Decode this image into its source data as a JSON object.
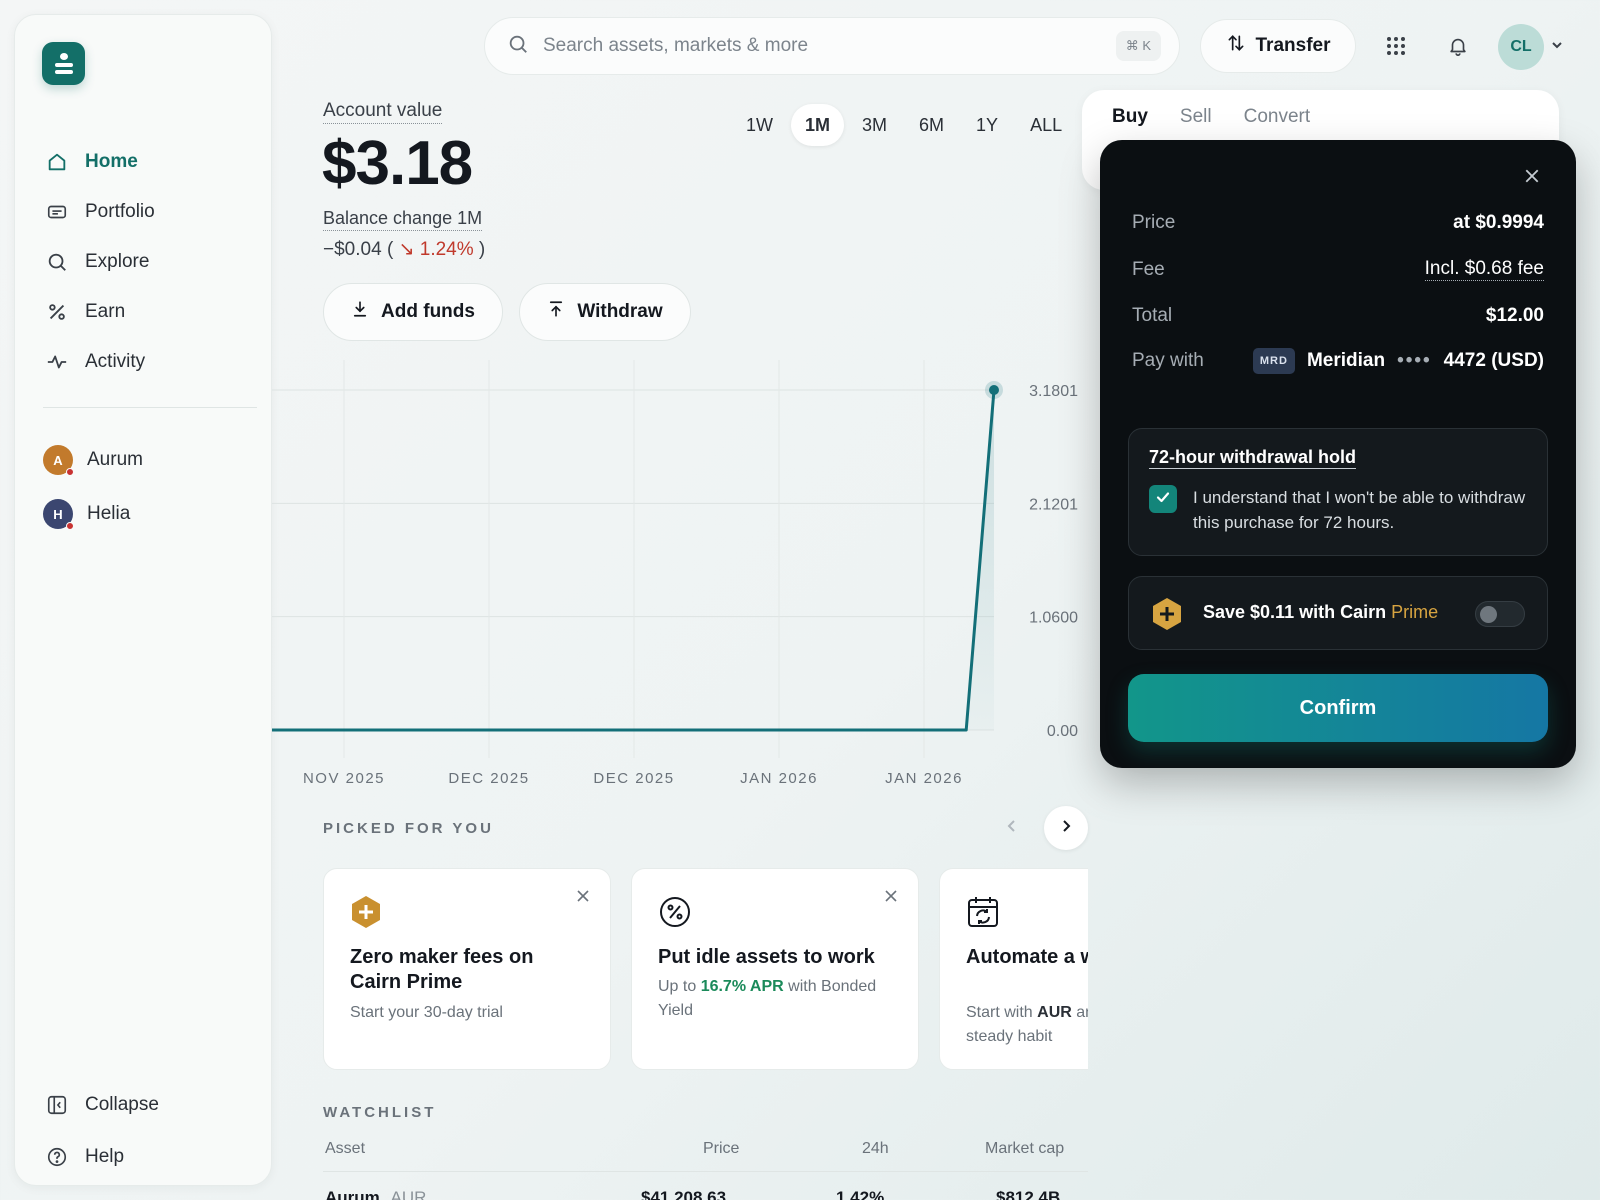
{
  "sidebar": {
    "nav": [
      {
        "label": "Home",
        "icon": "home-icon"
      },
      {
        "label": "Portfolio",
        "icon": "wallet-icon"
      },
      {
        "label": "Explore",
        "icon": "search-icon"
      },
      {
        "label": "Earn",
        "icon": "percent-icon"
      },
      {
        "label": "Activity",
        "icon": "activity-icon"
      }
    ],
    "wallets": [
      {
        "initial": "A",
        "label": "Aurum",
        "color": "#c27a2c"
      },
      {
        "initial": "H",
        "label": "Helia",
        "color": "#3b4670"
      }
    ],
    "collapse_label": "Collapse",
    "help_label": "Help"
  },
  "topbar": {
    "search_placeholder": "Search assets, markets & more",
    "search_shortcut": "⌘ K",
    "transfer_label": "Transfer",
    "avatar_initials": "CL"
  },
  "account": {
    "label": "Account value",
    "value": "$3.18",
    "balance_label": "Balance change 1M",
    "balance_change": "−$0.04",
    "balance_pct": "1.24%",
    "add_funds_label": "Add funds",
    "withdraw_label": "Withdraw"
  },
  "ranges": {
    "options": [
      "1W",
      "1M",
      "3M",
      "6M",
      "1Y",
      "ALL"
    ],
    "selected": "1M"
  },
  "chart_data": {
    "type": "line",
    "x_tick_labels": [
      "NOV 2025",
      "DEC 2025",
      "DEC 2025",
      "JAN 2026",
      "JAN 2026"
    ],
    "y_tick_labels": [
      "3.1801",
      "2.1201",
      "1.0600",
      "0.00"
    ],
    "ylim": [
      0,
      3.1801
    ],
    "values": [
      0,
      0,
      0,
      0,
      0,
      0,
      0,
      0,
      0,
      0,
      0,
      0,
      0,
      0,
      0,
      0,
      0,
      0,
      0,
      0,
      0,
      0,
      0,
      0,
      0,
      0,
      3.1801
    ],
    "color": "#136f78",
    "grid": true
  },
  "picked": {
    "title": "PICKED FOR YOU",
    "cards": [
      {
        "icon": "prime-hexagon-icon",
        "title": "Zero maker fees on Cairn Prime",
        "sub": "Start your 30-day trial"
      },
      {
        "icon": "percent-circle-icon",
        "title": "Put idle assets to work",
        "sub_prefix": "Up to ",
        "sub_highlight": "16.7% APR",
        "sub_suffix": " with Bonded Yield"
      },
      {
        "icon": "calendar-repeat-icon",
        "title": "Automate a weekly buy",
        "sub_prefix": "Start with ",
        "sub_bold": "AUR",
        "sub_suffix": " and build a steady habit"
      }
    ]
  },
  "watchlist": {
    "title": "WATCHLIST",
    "columns": [
      "Asset",
      "Price",
      "24h",
      "Market cap"
    ],
    "rows": [
      {
        "asset": "Aurum",
        "ticker": "AUR",
        "price": "$41,208.63",
        "change": "1.42%",
        "market_cap": "$812.4B"
      }
    ]
  },
  "trade": {
    "tabs": [
      "Buy",
      "Sell",
      "Convert"
    ],
    "active_tab": "Buy",
    "price_label": "Price",
    "price_value": "at $0.9994",
    "fee_label": "Fee",
    "fee_value": "Incl. $0.68 fee",
    "total_label": "Total",
    "total_value": "$12.00",
    "paywith_label": "Pay with",
    "card_badge": "MRD",
    "card_name": "Meridian",
    "card_mask": "••••",
    "card_last": "4472 (USD)",
    "hold_title": "72-hour withdrawal hold",
    "hold_text": "I understand that I won't be able to withdraw this purchase for 72 hours.",
    "hold_checked": true,
    "prime_prefix": "Save $0.11 with Cairn ",
    "prime_highlight": "Prime",
    "prime_enabled": false,
    "confirm_label": "Confirm"
  }
}
